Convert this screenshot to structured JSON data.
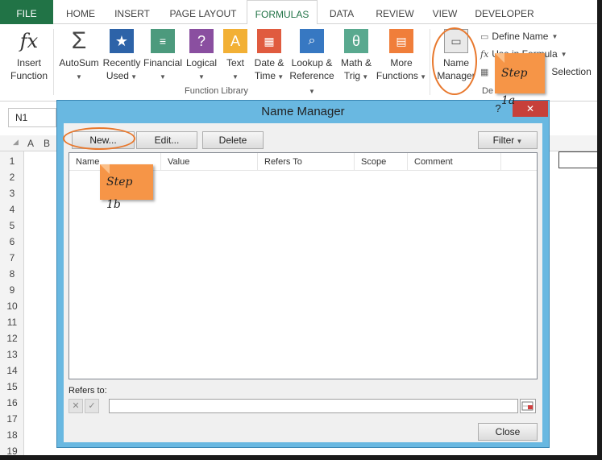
{
  "tabs": [
    "FILE",
    "HOME",
    "INSERT",
    "PAGE LAYOUT",
    "FORMULAS",
    "DATA",
    "REVIEW",
    "VIEW",
    "DEVELOPER"
  ],
  "ribbon": {
    "insert_function": [
      "Insert",
      "Function"
    ],
    "autosum": "AutoSum",
    "recently_used": [
      "Recently",
      "Used"
    ],
    "financial": "Financial",
    "logical": "Logical",
    "text": "Text",
    "date_time": [
      "Date &",
      "Time"
    ],
    "lookup_reference": [
      "Lookup &",
      "Reference"
    ],
    "math_trig": [
      "Math &",
      "Trig"
    ],
    "more_functions": [
      "More",
      "Functions"
    ],
    "group_label": "Function Library",
    "name_manager": [
      "Name",
      "Manager"
    ],
    "define_name": "Define Name",
    "use_in_formula": "Use in Formula",
    "from_selection": "Selection",
    "defined_names_group_fragment": "De"
  },
  "formula_bar": {
    "name_box": "N1"
  },
  "grid": {
    "col_headers": [
      "A",
      "B"
    ],
    "rows": [
      "1",
      "2",
      "3",
      "4",
      "5",
      "6",
      "7",
      "8",
      "9",
      "10",
      "11",
      "12",
      "13",
      "14",
      "15",
      "16",
      "17",
      "18",
      "19"
    ]
  },
  "dialog": {
    "title": "Name Manager",
    "help": "?",
    "close_glyph": "✕",
    "buttons": {
      "new": "New...",
      "edit": "Edit...",
      "delete": "Delete",
      "filter": "Filter",
      "close": "Close"
    },
    "columns": [
      "Name",
      "Value",
      "Refers To",
      "Scope",
      "Comment"
    ],
    "refers_to_label": "Refers to:",
    "refers_to_value": ""
  },
  "callouts": {
    "step_1a": "Step 1a",
    "step_1b": "Step 1b"
  },
  "colors": {
    "file_tab": "#217346",
    "accent": "#217346",
    "dialog_frame": "#69b8e1",
    "callout": "#f69547",
    "highlight_ring": "#e8782d"
  }
}
